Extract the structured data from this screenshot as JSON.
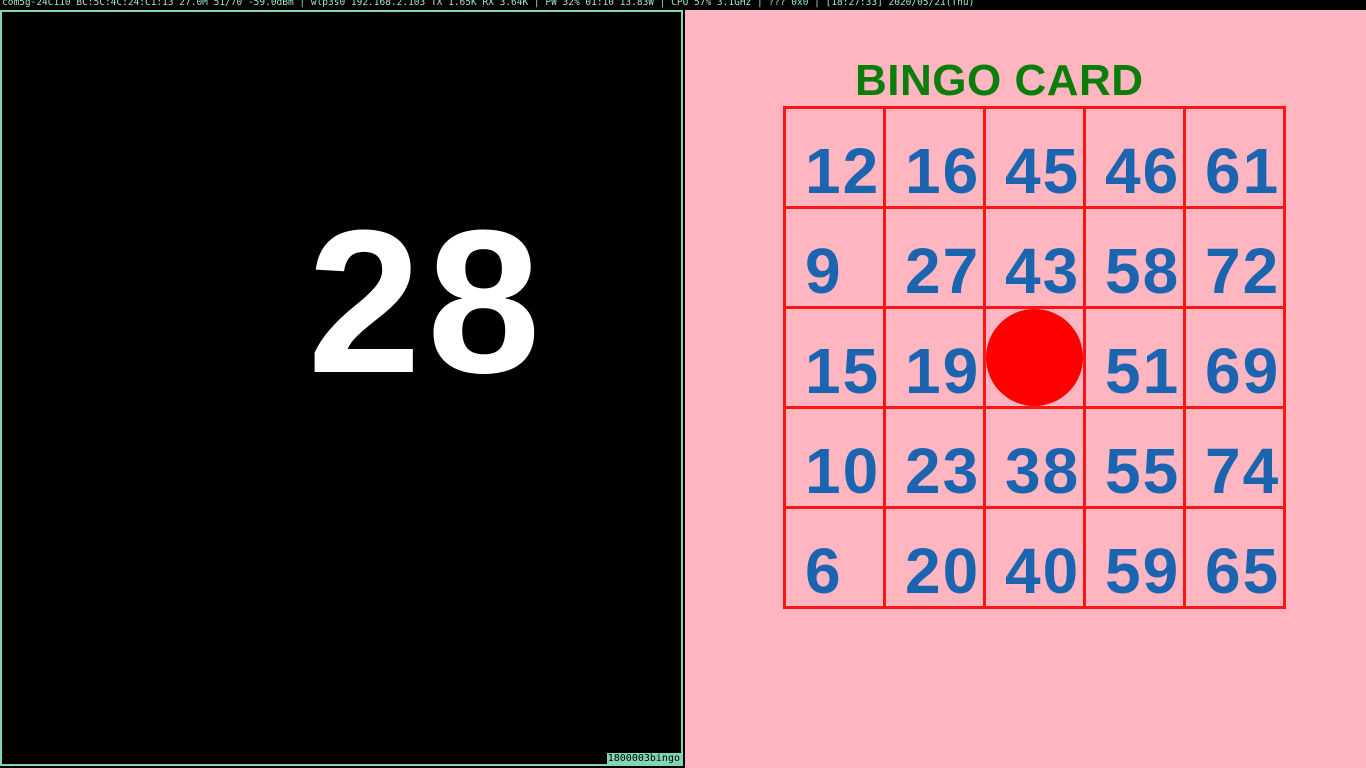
{
  "status_bar": {
    "text": "com5g-24C110 BC:5C:4C:24:C1:13 27.0M 51/70 -59.0dBm | wlp3s0 192.168.2.103   TX 1.65K RX 3.64K | PW  32% 01:10 13.83W | CPU 57% 3.1GHz | ???  0x0  | [18:27:33] 2020/05/21(Thu)"
  },
  "called_number": "28",
  "window_tag": "1800003bingo",
  "card": {
    "title": "BINGO CARD",
    "rows": [
      [
        "12",
        "16",
        "45",
        "46",
        "61"
      ],
      [
        "9",
        "27",
        "43",
        "58",
        "72"
      ],
      [
        "15",
        "19",
        "",
        "51",
        "69"
      ],
      [
        "10",
        "23",
        "38",
        "55",
        "74"
      ],
      [
        "6",
        "20",
        "40",
        "59",
        "65"
      ]
    ],
    "free_cell": [
      2,
      2
    ]
  },
  "colors": {
    "card_background": "#ffb6c1",
    "grid_lines": "#ff1414",
    "numbers": "#1a64b0",
    "title": "#0b7d0b",
    "free_marker": "#ff0000",
    "called_number": "#ffffff"
  }
}
